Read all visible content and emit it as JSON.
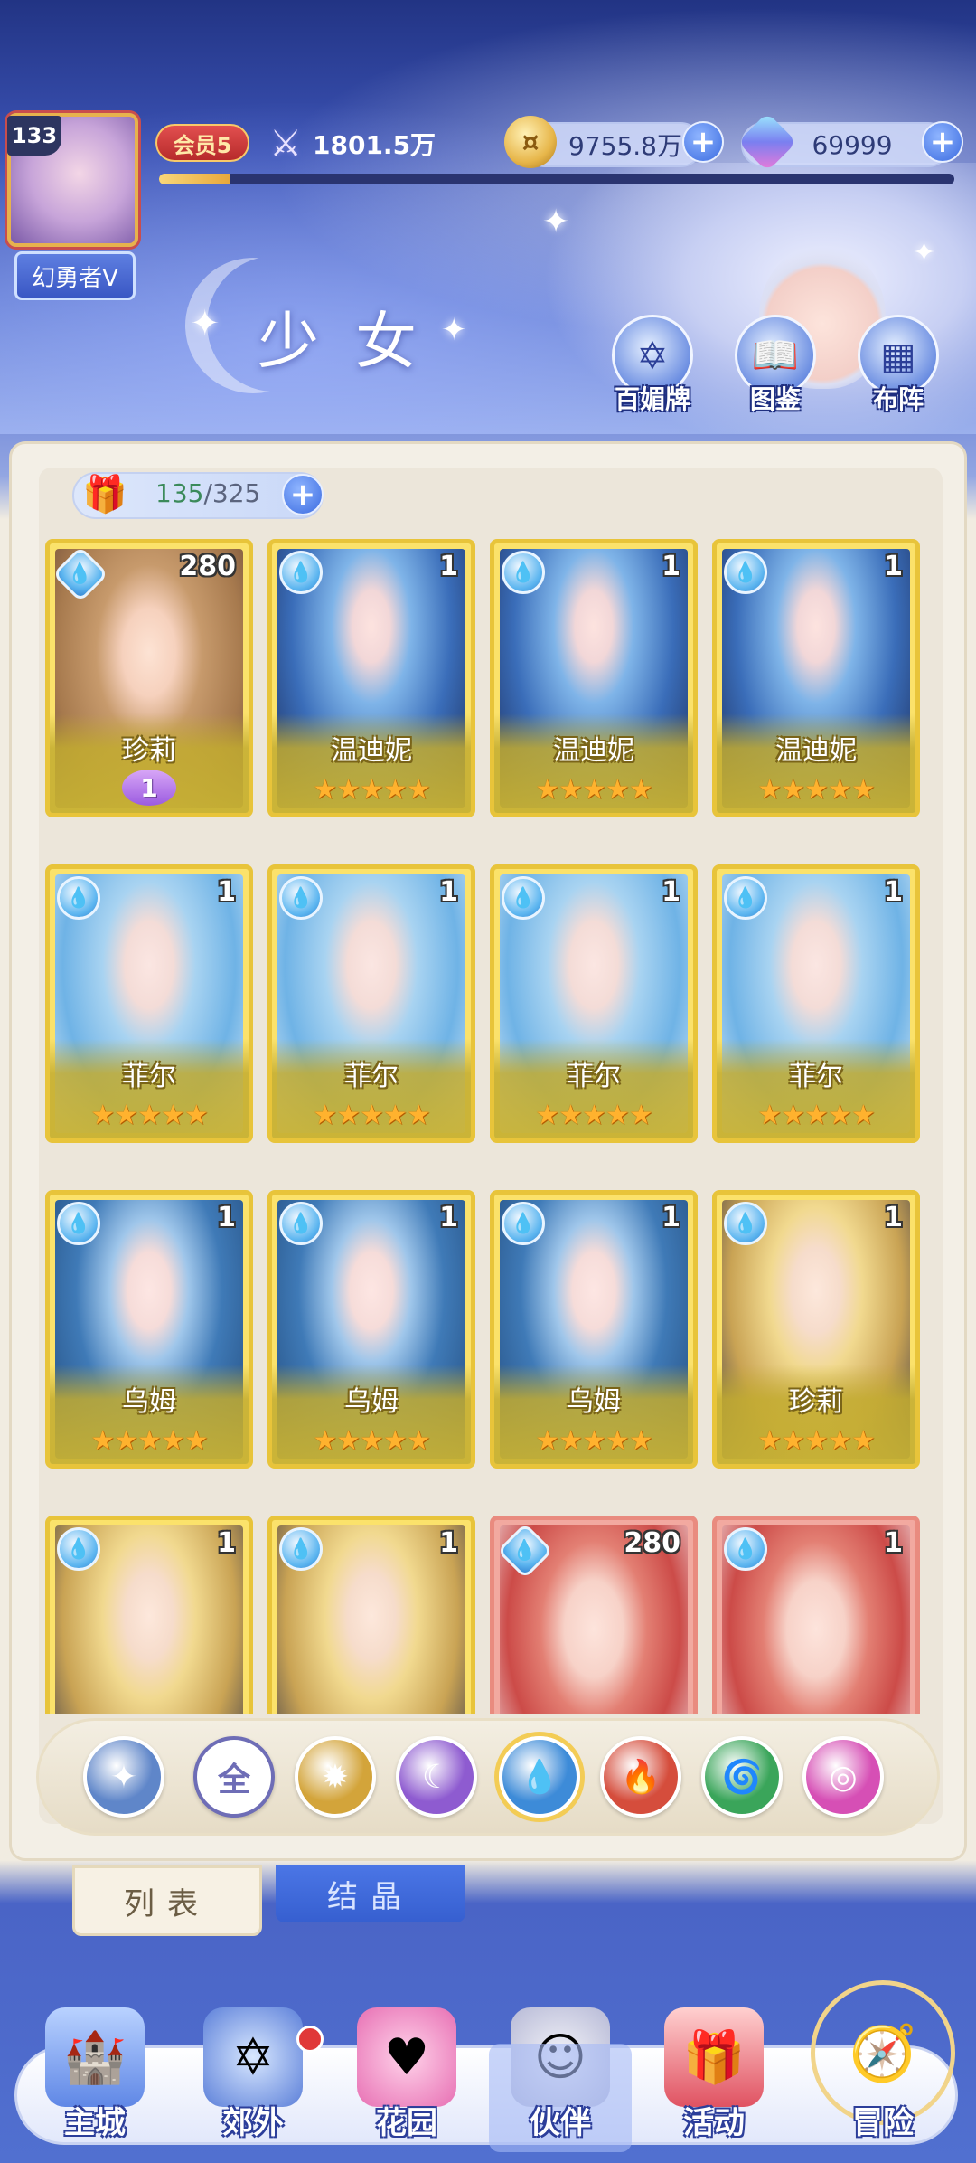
{
  "player": {
    "level": "133",
    "name": "幻勇者V",
    "vip": "会员5",
    "power": "1801.5万",
    "exp_progress": 0.09
  },
  "resources": {
    "gold": "9755.8万",
    "gems": "69999"
  },
  "header": {
    "section_title": "少女",
    "buttons": [
      {
        "label": "百媚牌",
        "icon": "card-deck-icon"
      },
      {
        "label": "图鉴",
        "icon": "book-icon"
      },
      {
        "label": "布阵",
        "icon": "formation-grid-icon"
      }
    ]
  },
  "capacity": {
    "current": "135",
    "max": "/325"
  },
  "cards": [
    {
      "name": "珍莉",
      "count": "280",
      "element": "diamond",
      "art": "brown",
      "stars": "",
      "badge": "1"
    },
    {
      "name": "温迪妮",
      "count": "1",
      "element": "water",
      "art": "blue-dark",
      "stars": "★★★★★",
      "badge": ""
    },
    {
      "name": "温迪妮",
      "count": "1",
      "element": "water",
      "art": "blue-dark",
      "stars": "★★★★★",
      "badge": ""
    },
    {
      "name": "温迪妮",
      "count": "1",
      "element": "water",
      "art": "blue-dark",
      "stars": "★★★★★",
      "badge": ""
    },
    {
      "name": "菲尔",
      "count": "1",
      "element": "water",
      "art": "blue-light",
      "stars": "★★★★★",
      "badge": ""
    },
    {
      "name": "菲尔",
      "count": "1",
      "element": "water",
      "art": "blue-light",
      "stars": "★★★★★",
      "badge": ""
    },
    {
      "name": "菲尔",
      "count": "1",
      "element": "water",
      "art": "blue-light",
      "stars": "★★★★★",
      "badge": ""
    },
    {
      "name": "菲尔",
      "count": "1",
      "element": "water",
      "art": "blue-light",
      "stars": "★★★★★",
      "badge": ""
    },
    {
      "name": "乌姆",
      "count": "1",
      "element": "water",
      "art": "blue-hood",
      "stars": "★★★★★",
      "badge": ""
    },
    {
      "name": "乌姆",
      "count": "1",
      "element": "water",
      "art": "blue-hood",
      "stars": "★★★★★",
      "badge": ""
    },
    {
      "name": "乌姆",
      "count": "1",
      "element": "water",
      "art": "blue-hood",
      "stars": "★★★★★",
      "badge": ""
    },
    {
      "name": "珍莉",
      "count": "1",
      "element": "water",
      "art": "blonde",
      "stars": "★★★★★",
      "badge": ""
    },
    {
      "name": "",
      "count": "1",
      "element": "water",
      "art": "blonde",
      "stars": "",
      "badge": ""
    },
    {
      "name": "",
      "count": "1",
      "element": "water",
      "art": "blonde",
      "stars": "",
      "badge": ""
    },
    {
      "name": "",
      "count": "280",
      "element": "diamond",
      "art": "red",
      "stars": "",
      "badge": ""
    },
    {
      "name": "",
      "count": "1",
      "element": "water",
      "art": "red",
      "stars": "",
      "badge": ""
    }
  ],
  "filters": [
    {
      "name": "wind",
      "glyph": "✦",
      "color": "#5f86c9"
    },
    {
      "name": "all",
      "glyph": "全",
      "color": "#6e6db6"
    },
    {
      "name": "light",
      "glyph": "✹",
      "color": "#d3a43a"
    },
    {
      "name": "dark",
      "glyph": "☾",
      "color": "#8e5bd0"
    },
    {
      "name": "water",
      "glyph": "💧",
      "color": "#3d8bd8"
    },
    {
      "name": "fire",
      "glyph": "🔥",
      "color": "#d54d3c"
    },
    {
      "name": "earth",
      "glyph": "🌀",
      "color": "#3aa55a"
    },
    {
      "name": "ring",
      "glyph": "◎",
      "color": "#d64fb5"
    }
  ],
  "selected_filter": "water",
  "tabs": {
    "list": "列表",
    "crystal": "结晶"
  },
  "nav": {
    "items": [
      {
        "label": "主城",
        "icon": "castle-icon"
      },
      {
        "label": "郊外",
        "icon": "portal-icon"
      },
      {
        "label": "花园",
        "icon": "heart-icon"
      },
      {
        "label": "伙伴",
        "icon": "companion-icon"
      },
      {
        "label": "活动",
        "icon": "gift-icon"
      },
      {
        "label": "冒险",
        "icon": "compass-icon"
      }
    ],
    "active": "伙伴"
  }
}
